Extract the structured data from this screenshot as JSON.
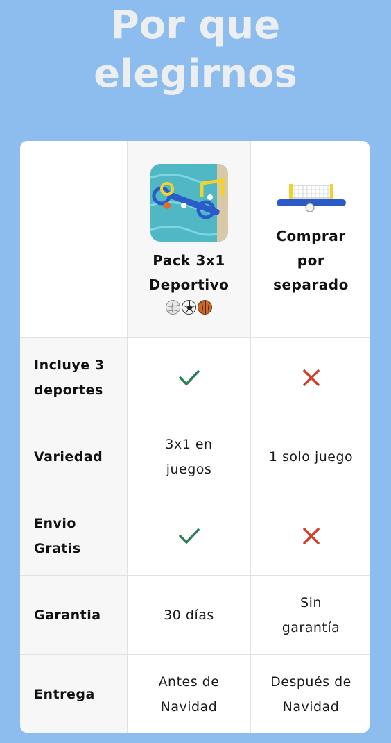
{
  "title_line1": "Por que",
  "title_line2": "elegirnos",
  "colors": {
    "background": "#8dbcee",
    "check": "#2e7d5b",
    "cross": "#d0402b"
  },
  "columns": {
    "ours": {
      "name_line1": "Pack 3x1",
      "name_line2": "Deportivo",
      "image_icon": "pool-games-pack-image",
      "balls": [
        "volleyball-icon",
        "soccer-ball-icon",
        "basketball-icon"
      ]
    },
    "other": {
      "name_line1": "Comprar",
      "name_line2": "por",
      "name_line3": "separado",
      "image_icon": "pool-volleyball-net-image"
    }
  },
  "rows": [
    {
      "label_line1": "Incluye 3",
      "label_line2": "deportes",
      "ours": "check-icon",
      "other": "cross-icon"
    },
    {
      "label_line1": "Variedad",
      "ours_line1": "3x1 en",
      "ours_line2": "juegos",
      "other_line1": "1 solo juego"
    },
    {
      "label_line1": "Envio",
      "label_line2": "Gratis",
      "ours": "check-icon",
      "other": "cross-icon"
    },
    {
      "label_line1": "Garantia",
      "ours_line1": "30 días",
      "other_line1": "Sin",
      "other_line2": "garantía"
    },
    {
      "label_line1": "Entrega",
      "ours_line1": "Antes de",
      "ours_line2": "Navidad",
      "other_line1": "Después de",
      "other_line2": "Navidad"
    }
  ]
}
